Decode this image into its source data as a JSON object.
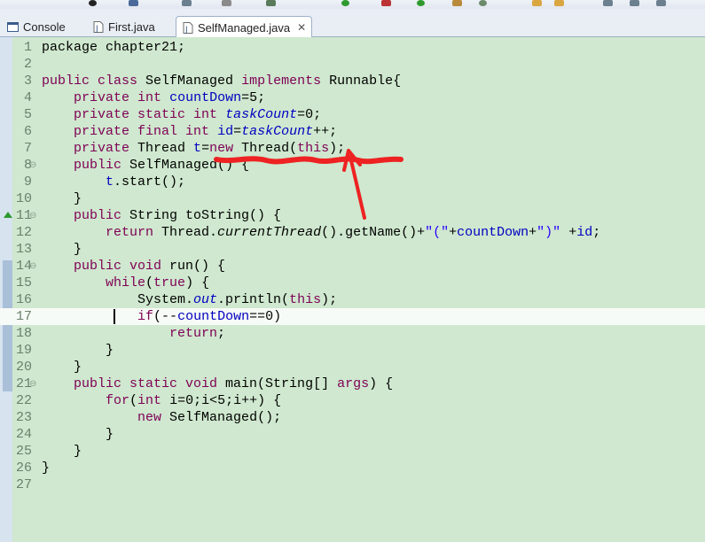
{
  "tabs": [
    {
      "label": "Console",
      "icon": "console-icon"
    },
    {
      "label": "First.java",
      "icon": "java-file-icon"
    },
    {
      "label": "SelfManaged.java",
      "icon": "java-file-icon",
      "active": true
    }
  ],
  "editor": {
    "current_line": 17,
    "lines": [
      {
        "n": "1",
        "tokens": [
          {
            "t": "package chapter21;"
          }
        ]
      },
      {
        "n": "2",
        "tokens": []
      },
      {
        "n": "3",
        "tokens": [
          {
            "t": "public class",
            "c": "kw"
          },
          {
            "t": " SelfManaged "
          },
          {
            "t": "implements",
            "c": "kw"
          },
          {
            "t": " Runnable{"
          }
        ]
      },
      {
        "n": "4",
        "tokens": [
          {
            "t": "    "
          },
          {
            "t": "private int",
            "c": "kw"
          },
          {
            "t": " "
          },
          {
            "t": "countDown",
            "c": "fld"
          },
          {
            "t": "=5;"
          }
        ]
      },
      {
        "n": "5",
        "tokens": [
          {
            "t": "    "
          },
          {
            "t": "private static int",
            "c": "kw"
          },
          {
            "t": " "
          },
          {
            "t": "taskCount",
            "c": "sfld"
          },
          {
            "t": "=0;"
          }
        ]
      },
      {
        "n": "6",
        "tokens": [
          {
            "t": "    "
          },
          {
            "t": "private final int",
            "c": "kw"
          },
          {
            "t": " "
          },
          {
            "t": "id",
            "c": "fld"
          },
          {
            "t": "="
          },
          {
            "t": "taskCount",
            "c": "sfld"
          },
          {
            "t": "++;"
          }
        ]
      },
      {
        "n": "7",
        "tokens": [
          {
            "t": "    "
          },
          {
            "t": "private",
            "c": "kw"
          },
          {
            "t": " Thread "
          },
          {
            "t": "t",
            "c": "fld"
          },
          {
            "t": "="
          },
          {
            "t": "new",
            "c": "kw"
          },
          {
            "t": " Thread("
          },
          {
            "t": "this",
            "c": "kw"
          },
          {
            "t": ");"
          }
        ]
      },
      {
        "n": "8",
        "fold": true,
        "tokens": [
          {
            "t": "    "
          },
          {
            "t": "public",
            "c": "kw"
          },
          {
            "t": " SelfManaged() {"
          }
        ]
      },
      {
        "n": "9",
        "tokens": [
          {
            "t": "        "
          },
          {
            "t": "t",
            "c": "fld"
          },
          {
            "t": ".start();"
          }
        ]
      },
      {
        "n": "10",
        "tokens": [
          {
            "t": "    }"
          }
        ]
      },
      {
        "n": "11",
        "fold": true,
        "override": true,
        "tokens": [
          {
            "t": "    "
          },
          {
            "t": "public",
            "c": "kw"
          },
          {
            "t": " String toString() {"
          }
        ]
      },
      {
        "n": "12",
        "tokens": [
          {
            "t": "        "
          },
          {
            "t": "return",
            "c": "kw"
          },
          {
            "t": " Thread."
          },
          {
            "t": "currentThread",
            "c": "ital"
          },
          {
            "t": "().getName()+"
          },
          {
            "t": "\"(\"",
            "c": "str"
          },
          {
            "t": "+"
          },
          {
            "t": "countDown",
            "c": "fld"
          },
          {
            "t": "+"
          },
          {
            "t": "\")\"",
            "c": "str"
          },
          {
            "t": " +"
          },
          {
            "t": "id",
            "c": "fld"
          },
          {
            "t": ";"
          }
        ]
      },
      {
        "n": "13",
        "tokens": [
          {
            "t": "    }"
          }
        ]
      },
      {
        "n": "14",
        "fold": true,
        "tokens": [
          {
            "t": "    "
          },
          {
            "t": "public void",
            "c": "kw"
          },
          {
            "t": " run() {"
          }
        ]
      },
      {
        "n": "15",
        "tokens": [
          {
            "t": "        "
          },
          {
            "t": "while",
            "c": "kw"
          },
          {
            "t": "("
          },
          {
            "t": "true",
            "c": "kw"
          },
          {
            "t": ") {"
          }
        ]
      },
      {
        "n": "16",
        "tokens": [
          {
            "t": "            System."
          },
          {
            "t": "out",
            "c": "sfld"
          },
          {
            "t": ".println("
          },
          {
            "t": "this",
            "c": "kw"
          },
          {
            "t": ");"
          }
        ]
      },
      {
        "n": "17",
        "tokens": [
          {
            "t": "            "
          },
          {
            "t": "if",
            "c": "kw"
          },
          {
            "t": "(--"
          },
          {
            "t": "countDown",
            "c": "fld"
          },
          {
            "t": "==0)"
          }
        ]
      },
      {
        "n": "18",
        "tokens": [
          {
            "t": "                "
          },
          {
            "t": "return",
            "c": "kw"
          },
          {
            "t": ";"
          }
        ]
      },
      {
        "n": "19",
        "tokens": [
          {
            "t": "        }"
          }
        ]
      },
      {
        "n": "20",
        "tokens": [
          {
            "t": "    }"
          }
        ]
      },
      {
        "n": "21",
        "fold": true,
        "tokens": [
          {
            "t": "    "
          },
          {
            "t": "public static void",
            "c": "kw"
          },
          {
            "t": " main(String[] "
          },
          {
            "t": "args",
            "c": "kw"
          },
          {
            "t": ") {"
          }
        ]
      },
      {
        "n": "22",
        "tokens": [
          {
            "t": "        "
          },
          {
            "t": "for",
            "c": "kw"
          },
          {
            "t": "("
          },
          {
            "t": "int",
            "c": "kw"
          },
          {
            "t": " i=0;i<5;i++) {"
          }
        ]
      },
      {
        "n": "23",
        "tokens": [
          {
            "t": "            "
          },
          {
            "t": "new",
            "c": "kw"
          },
          {
            "t": " SelfManaged();"
          }
        ]
      },
      {
        "n": "24",
        "tokens": [
          {
            "t": "        }"
          }
        ]
      },
      {
        "n": "25",
        "tokens": [
          {
            "t": "    }"
          }
        ]
      },
      {
        "n": "26",
        "tokens": [
          {
            "t": "}"
          }
        ]
      },
      {
        "n": "27",
        "tokens": []
      }
    ]
  },
  "colors": {
    "editor_bg": "#cfe8cf",
    "keyword": "#7f0055",
    "field": "#0000c0",
    "string": "#2a00ff",
    "annotation": "#ee2222"
  }
}
